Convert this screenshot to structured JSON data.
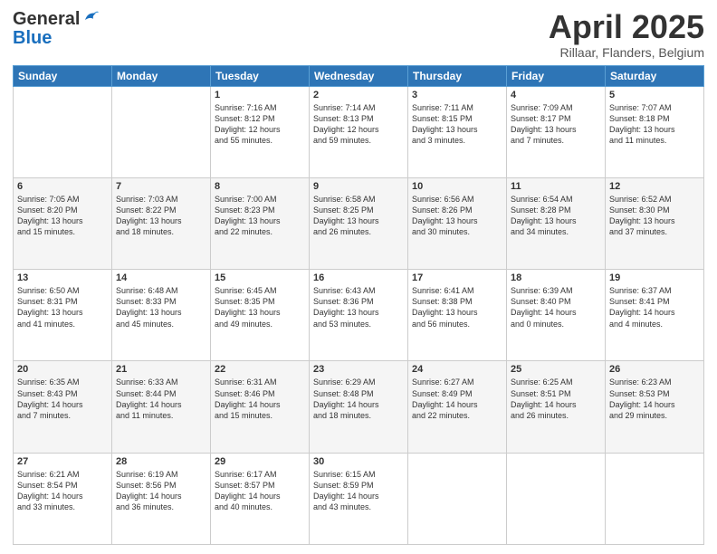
{
  "header": {
    "logo_general": "General",
    "logo_blue": "Blue",
    "month_title": "April 2025",
    "location": "Rillaar, Flanders, Belgium"
  },
  "days_of_week": [
    "Sunday",
    "Monday",
    "Tuesday",
    "Wednesday",
    "Thursday",
    "Friday",
    "Saturday"
  ],
  "weeks": [
    [
      {
        "day": "",
        "info": ""
      },
      {
        "day": "",
        "info": ""
      },
      {
        "day": "1",
        "info": "Sunrise: 7:16 AM\nSunset: 8:12 PM\nDaylight: 12 hours\nand 55 minutes."
      },
      {
        "day": "2",
        "info": "Sunrise: 7:14 AM\nSunset: 8:13 PM\nDaylight: 12 hours\nand 59 minutes."
      },
      {
        "day": "3",
        "info": "Sunrise: 7:11 AM\nSunset: 8:15 PM\nDaylight: 13 hours\nand 3 minutes."
      },
      {
        "day": "4",
        "info": "Sunrise: 7:09 AM\nSunset: 8:17 PM\nDaylight: 13 hours\nand 7 minutes."
      },
      {
        "day": "5",
        "info": "Sunrise: 7:07 AM\nSunset: 8:18 PM\nDaylight: 13 hours\nand 11 minutes."
      }
    ],
    [
      {
        "day": "6",
        "info": "Sunrise: 7:05 AM\nSunset: 8:20 PM\nDaylight: 13 hours\nand 15 minutes."
      },
      {
        "day": "7",
        "info": "Sunrise: 7:03 AM\nSunset: 8:22 PM\nDaylight: 13 hours\nand 18 minutes."
      },
      {
        "day": "8",
        "info": "Sunrise: 7:00 AM\nSunset: 8:23 PM\nDaylight: 13 hours\nand 22 minutes."
      },
      {
        "day": "9",
        "info": "Sunrise: 6:58 AM\nSunset: 8:25 PM\nDaylight: 13 hours\nand 26 minutes."
      },
      {
        "day": "10",
        "info": "Sunrise: 6:56 AM\nSunset: 8:26 PM\nDaylight: 13 hours\nand 30 minutes."
      },
      {
        "day": "11",
        "info": "Sunrise: 6:54 AM\nSunset: 8:28 PM\nDaylight: 13 hours\nand 34 minutes."
      },
      {
        "day": "12",
        "info": "Sunrise: 6:52 AM\nSunset: 8:30 PM\nDaylight: 13 hours\nand 37 minutes."
      }
    ],
    [
      {
        "day": "13",
        "info": "Sunrise: 6:50 AM\nSunset: 8:31 PM\nDaylight: 13 hours\nand 41 minutes."
      },
      {
        "day": "14",
        "info": "Sunrise: 6:48 AM\nSunset: 8:33 PM\nDaylight: 13 hours\nand 45 minutes."
      },
      {
        "day": "15",
        "info": "Sunrise: 6:45 AM\nSunset: 8:35 PM\nDaylight: 13 hours\nand 49 minutes."
      },
      {
        "day": "16",
        "info": "Sunrise: 6:43 AM\nSunset: 8:36 PM\nDaylight: 13 hours\nand 53 minutes."
      },
      {
        "day": "17",
        "info": "Sunrise: 6:41 AM\nSunset: 8:38 PM\nDaylight: 13 hours\nand 56 minutes."
      },
      {
        "day": "18",
        "info": "Sunrise: 6:39 AM\nSunset: 8:40 PM\nDaylight: 14 hours\nand 0 minutes."
      },
      {
        "day": "19",
        "info": "Sunrise: 6:37 AM\nSunset: 8:41 PM\nDaylight: 14 hours\nand 4 minutes."
      }
    ],
    [
      {
        "day": "20",
        "info": "Sunrise: 6:35 AM\nSunset: 8:43 PM\nDaylight: 14 hours\nand 7 minutes."
      },
      {
        "day": "21",
        "info": "Sunrise: 6:33 AM\nSunset: 8:44 PM\nDaylight: 14 hours\nand 11 minutes."
      },
      {
        "day": "22",
        "info": "Sunrise: 6:31 AM\nSunset: 8:46 PM\nDaylight: 14 hours\nand 15 minutes."
      },
      {
        "day": "23",
        "info": "Sunrise: 6:29 AM\nSunset: 8:48 PM\nDaylight: 14 hours\nand 18 minutes."
      },
      {
        "day": "24",
        "info": "Sunrise: 6:27 AM\nSunset: 8:49 PM\nDaylight: 14 hours\nand 22 minutes."
      },
      {
        "day": "25",
        "info": "Sunrise: 6:25 AM\nSunset: 8:51 PM\nDaylight: 14 hours\nand 26 minutes."
      },
      {
        "day": "26",
        "info": "Sunrise: 6:23 AM\nSunset: 8:53 PM\nDaylight: 14 hours\nand 29 minutes."
      }
    ],
    [
      {
        "day": "27",
        "info": "Sunrise: 6:21 AM\nSunset: 8:54 PM\nDaylight: 14 hours\nand 33 minutes."
      },
      {
        "day": "28",
        "info": "Sunrise: 6:19 AM\nSunset: 8:56 PM\nDaylight: 14 hours\nand 36 minutes."
      },
      {
        "day": "29",
        "info": "Sunrise: 6:17 AM\nSunset: 8:57 PM\nDaylight: 14 hours\nand 40 minutes."
      },
      {
        "day": "30",
        "info": "Sunrise: 6:15 AM\nSunset: 8:59 PM\nDaylight: 14 hours\nand 43 minutes."
      },
      {
        "day": "",
        "info": ""
      },
      {
        "day": "",
        "info": ""
      },
      {
        "day": "",
        "info": ""
      }
    ]
  ]
}
